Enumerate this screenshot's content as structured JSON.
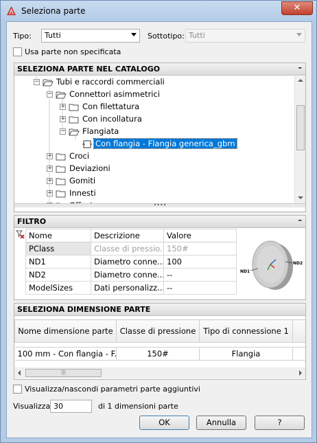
{
  "window": {
    "title": "Seleziona parte",
    "close_glyph": "✕"
  },
  "top": {
    "tipo_label": "Tipo:",
    "tipo_value": "Tutti",
    "sottotipo_label": "Sottotipo:",
    "sottotipo_value": "Tutti",
    "unspecified_label": "Usa parte non specificata"
  },
  "catalog": {
    "header": "SELEZIONA PARTE NEL CATALOGO",
    "minimize": "–",
    "items": [
      {
        "label": "Tubi e raccordi commerciali",
        "icon": "folder-open-icon"
      },
      {
        "label": "Connettori asimmetrici",
        "icon": "folder-open-icon"
      },
      {
        "label": "Con filettatura",
        "icon": "folder-icon"
      },
      {
        "label": "Con incollatura",
        "icon": "folder-icon"
      },
      {
        "label": "Flangiata",
        "icon": "folder-open-icon"
      },
      {
        "label": "Con flangia - Flangia generica_gbm",
        "icon": "part-icon",
        "selected": true
      },
      {
        "label": "Croci",
        "icon": "folder-icon"
      },
      {
        "label": "Deviazioni",
        "icon": "folder-icon"
      },
      {
        "label": "Gomiti",
        "icon": "folder-icon"
      },
      {
        "label": "Innesti",
        "icon": "folder-icon"
      },
      {
        "label": "Offset",
        "icon": "folder-icon"
      }
    ]
  },
  "filter": {
    "header": "FILTRO",
    "minimize": "–",
    "columns": [
      "Nome",
      "Descrizione",
      "Valore"
    ],
    "rows": [
      {
        "name": "PClass",
        "desc": "Classe di pressio...",
        "value": "150#",
        "disabled": true
      },
      {
        "name": "ND1",
        "desc": "Diametro conne...",
        "value": "100"
      },
      {
        "name": "ND2",
        "desc": "Diametro conne...",
        "value": "--"
      },
      {
        "name": "ModelSizes",
        "desc": "Dati personalizz...",
        "value": "--"
      }
    ],
    "preview_labels": {
      "nd1": "ND1",
      "nd2": "ND2"
    }
  },
  "sizes": {
    "header": "SELEZIONA DIMENSIONE PARTE",
    "columns": [
      "Nome dimensione parte",
      "Classe di pressione",
      "Tipo di connessione 1"
    ],
    "rows": [
      {
        "name": "100 mm - Con flangia - F...",
        "pclass": "150#",
        "conn": "Flangia"
      }
    ]
  },
  "bottom": {
    "toggle_label": "Visualizza/nascondi parametri parte aggiuntivi",
    "show_label": "Visualizza",
    "show_value": "30",
    "count_text": "di 1 dimensioni parte",
    "ok": "OK",
    "cancel": "Annulla",
    "help": "?"
  },
  "colors": {
    "selection": "#0078d7",
    "title_bg": "#b9cfe8",
    "close_red": "#c94a36"
  }
}
